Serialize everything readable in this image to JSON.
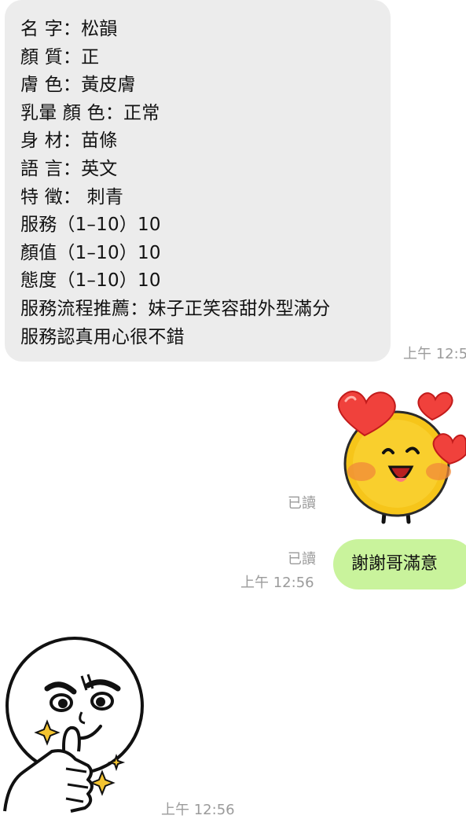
{
  "incoming_message": {
    "lines": [
      "名 字：松韻",
      "顏 質：正",
      "膚 色：黃皮膚",
      "乳暈 顏 色：正常",
      "身 材：苗條",
      "語 言：英文",
      "特 徵： 刺青",
      "服務（1–10）10",
      "顏值（1–10）10",
      "態度（1–10）10",
      "服務流程推薦：妹子正笑容甜外型滿分",
      "服務認真用心很不錯"
    ],
    "time": "上午 12:5"
  },
  "outgoing_sticker": {
    "icon": "heart-face-sticker-icon",
    "read_label": "已讀"
  },
  "outgoing_message": {
    "text": "謝謝哥滿意",
    "read_label": "已讀",
    "time": "上午 12:56"
  },
  "incoming_sticker": {
    "icon": "thumbs-up-sticker-icon",
    "time": "上午 12:56"
  },
  "colors": {
    "incoming_bubble": "#ececec",
    "outgoing_bubble": "#c9f39c",
    "meta_text": "#9b9b9b"
  }
}
